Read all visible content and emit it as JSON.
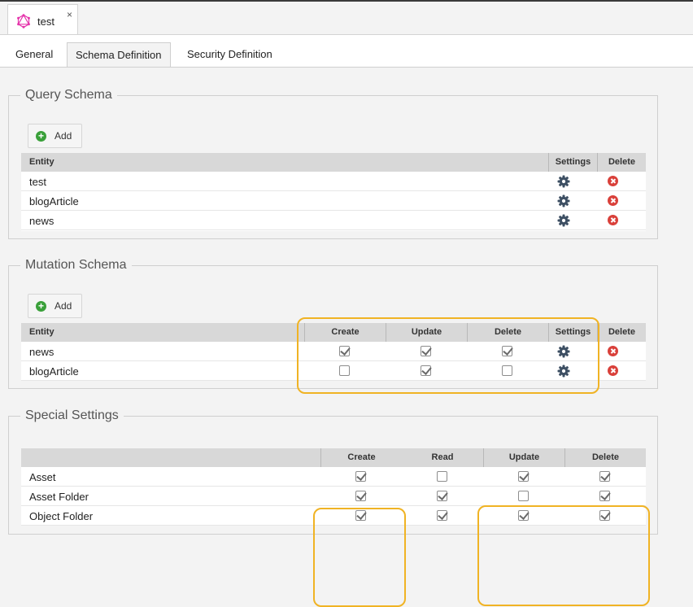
{
  "document_tab": {
    "title": "test",
    "close": "×"
  },
  "tabs": [
    {
      "label": "General",
      "active": false
    },
    {
      "label": "Schema Definition",
      "active": true
    },
    {
      "label": "Security Definition",
      "active": false
    }
  ],
  "query_schema": {
    "legend": "Query Schema",
    "add_label": "Add",
    "columns": [
      "Entity",
      "Settings",
      "Delete"
    ],
    "rows": [
      {
        "entity": "test"
      },
      {
        "entity": "blogArticle"
      },
      {
        "entity": "news"
      }
    ]
  },
  "mutation_schema": {
    "legend": "Mutation Schema",
    "add_label": "Add",
    "columns": [
      "Entity",
      "Create",
      "Update",
      "Delete",
      "Settings",
      "Delete"
    ],
    "rows": [
      {
        "entity": "news",
        "create": true,
        "update": true,
        "delete": true
      },
      {
        "entity": "blogArticle",
        "create": false,
        "update": true,
        "delete": false
      }
    ]
  },
  "special_settings": {
    "legend": "Special Settings",
    "columns": [
      "",
      "Create",
      "Read",
      "Update",
      "Delete"
    ],
    "rows": [
      {
        "entity": "Asset",
        "create": true,
        "read": false,
        "update": true,
        "delete": true
      },
      {
        "entity": "Asset Folder",
        "create": true,
        "read": true,
        "update": false,
        "delete": true
      },
      {
        "entity": "Object Folder",
        "create": true,
        "read": true,
        "update": true,
        "delete": true
      }
    ]
  },
  "icons": {
    "logo": "graphql-logo-icon",
    "add": "plus-circle-icon",
    "settings": "gear-icon",
    "delete": "delete-circle-icon"
  },
  "colors": {
    "highlight": "#f0b324",
    "delete_red": "#d9403a",
    "add_green": "#3aa03a",
    "gear": "#3d4f63",
    "logo_pink": "#e535ab"
  }
}
